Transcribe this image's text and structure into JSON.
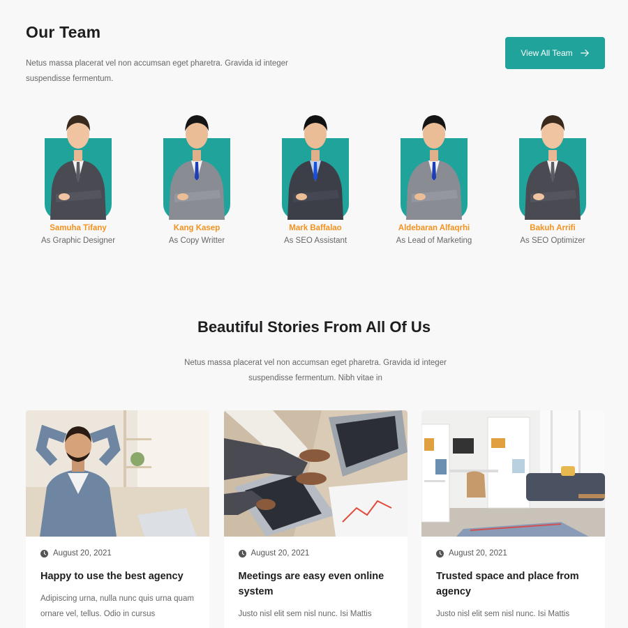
{
  "team": {
    "title": "Our Team",
    "description": "Netus massa placerat vel non accumsan eget pharetra. Gravida id integer suspendisse fermentum.",
    "view_all_label": "View All Team",
    "accent_color": "#1fa39a",
    "name_color": "#f5911e",
    "members": [
      {
        "name": "Samuha Tifany",
        "role": "As Graphic Designer"
      },
      {
        "name": "Kang Kasep",
        "role": "As Copy Writter"
      },
      {
        "name": "Mark Baffalao",
        "role": "As SEO Assistant"
      },
      {
        "name": "Aldebaran Alfaqrhi",
        "role": "As Lead of Marketing"
      },
      {
        "name": "Bakuh Arrifi",
        "role": "As SEO Optimizer"
      }
    ]
  },
  "stories": {
    "title": "Beautiful Stories From All Of Us",
    "description": "Netus massa placerat vel non accumsan eget pharetra. Gravida id integer suspendisse fermentum. Nibh vitae in",
    "cards": [
      {
        "date": "August 20, 2021",
        "title": "Happy to use the best agency",
        "excerpt": "Adipiscing urna, nulla nunc quis urna quam ornare vel, tellus. Odio in cursus"
      },
      {
        "date": "August 20, 2021",
        "title": "Meetings are easy even online system",
        "excerpt": "Justo nisl elit sem nisl nunc. Isi Mattis"
      },
      {
        "date": "August 20, 2021",
        "title": "Trusted space and place from agency",
        "excerpt": "Justo nisl elit sem nisl nunc. Isi Mattis"
      }
    ]
  }
}
